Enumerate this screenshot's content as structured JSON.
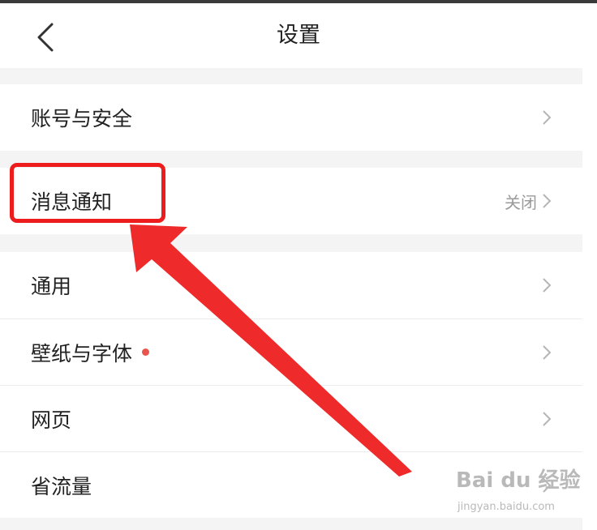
{
  "header": {
    "title": "设置",
    "back_icon": "chevron-left-icon"
  },
  "groups": [
    {
      "items": [
        {
          "key": "account",
          "label": "账号与安全",
          "value": "",
          "dot": false
        }
      ]
    },
    {
      "items": [
        {
          "key": "notifications",
          "label": "消息通知",
          "value": "关闭",
          "dot": false
        }
      ]
    },
    {
      "items": [
        {
          "key": "general",
          "label": "通用",
          "value": "",
          "dot": false
        },
        {
          "key": "wallpaper",
          "label": "壁纸与字体",
          "value": "",
          "dot": true
        },
        {
          "key": "web",
          "label": "网页",
          "value": "",
          "dot": false
        },
        {
          "key": "data-saver",
          "label": "省流量",
          "value": "",
          "dot": false
        }
      ]
    }
  ],
  "annotation": {
    "highlight_color": "#ee1d1d",
    "target": "消息通知"
  },
  "watermark": {
    "main": "Bai du 经验",
    "sub": "jingyan.baidu.com"
  }
}
